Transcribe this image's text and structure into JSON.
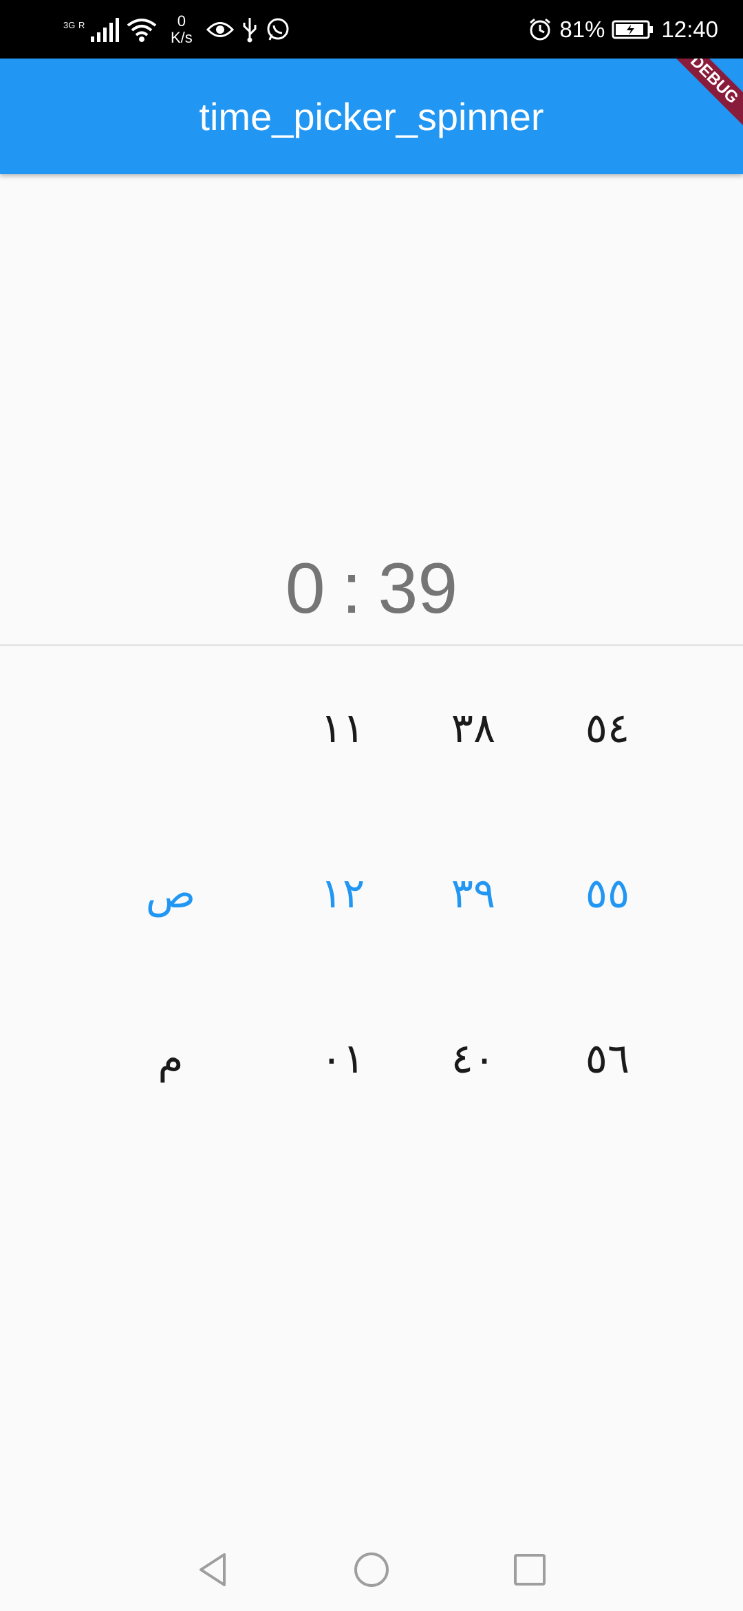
{
  "status_bar": {
    "network_type": "3G",
    "roaming": "R",
    "net_speed_value": "0",
    "net_speed_unit": "K/s",
    "battery_percent": "81%",
    "time": "12:40",
    "icons": [
      "signal-icon",
      "wifi-icon",
      "eye-icon",
      "usb-icon",
      "whatsapp-icon",
      "alarm-icon",
      "battery-icon"
    ]
  },
  "app_bar": {
    "title": "time_picker_spinner",
    "debug_label": "DEBUG"
  },
  "time_display": {
    "hour": "0",
    "separator": ":",
    "minute": "39"
  },
  "spinner": {
    "columns": [
      {
        "name": "ampm",
        "items": [
          "",
          "ص",
          "م"
        ],
        "selected_index": 1
      },
      {
        "name": "hour",
        "items": [
          "١١",
          "١٢",
          "٠١"
        ],
        "selected_index": 1
      },
      {
        "name": "minute",
        "items": [
          "٣٨",
          "٣٩",
          "٤٠"
        ],
        "selected_index": 1
      },
      {
        "name": "second",
        "items": [
          "٥٤",
          "٥٥",
          "٥٦"
        ],
        "selected_index": 1
      }
    ],
    "accent_color": "#2196f3",
    "text_color": "#1a1a1a"
  },
  "nav_bar": {
    "icons": [
      "back-icon",
      "home-icon",
      "recents-icon"
    ]
  },
  "colors": {
    "primary": "#2196f3",
    "background": "#fafafa",
    "readout": "#757575",
    "debug_banner": "#8a1c3b"
  }
}
